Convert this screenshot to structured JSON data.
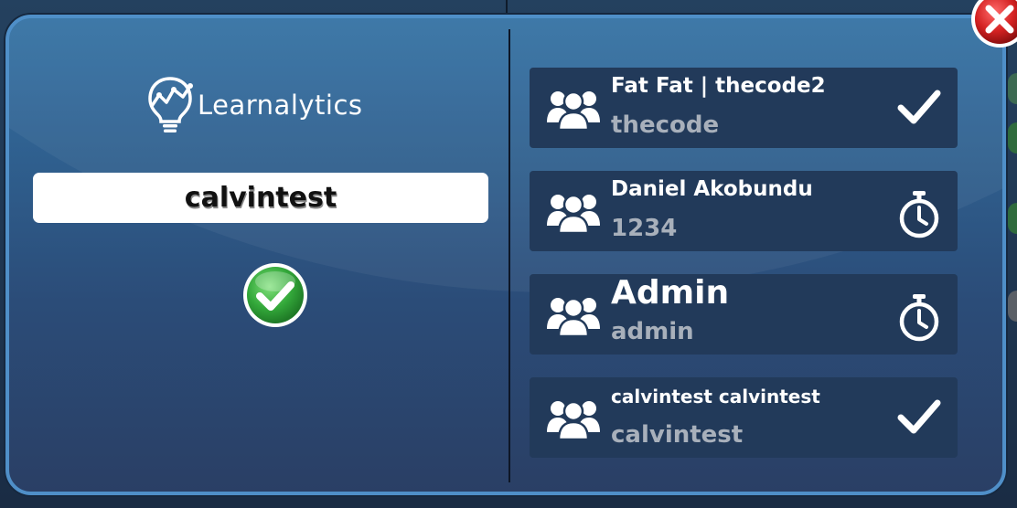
{
  "logo": {
    "text": "Learnalytics",
    "icon": "lightbulb-analytics-icon"
  },
  "selected_user": {
    "name": "calvintest",
    "status_icon": "green-check-badge-icon"
  },
  "users": [
    {
      "name": "Fat Fat | thecode2",
      "code": "thecode",
      "status": "check",
      "name_size": "large"
    },
    {
      "name": "Daniel Akobundu",
      "code": "1234",
      "status": "timer",
      "name_size": "large"
    },
    {
      "name": "Admin",
      "code": "admin",
      "status": "timer",
      "name_size": "xlarge"
    },
    {
      "name": "calvintest calvintest",
      "code": "calvintest",
      "status": "check",
      "name_size": "medium"
    }
  ],
  "icons": {
    "group": "users-group-icon",
    "check": "checkmark-icon",
    "timer": "stopwatch-icon",
    "close": "close-icon"
  },
  "colors": {
    "panel_top": "#3472a4",
    "panel_bottom": "#2a3f65",
    "panel_border": "#4f8fc8",
    "row_bg": "#223a5a",
    "code_text": "#a8b0bb",
    "ok_green": "#3cb043",
    "close_red": "#d42222"
  }
}
